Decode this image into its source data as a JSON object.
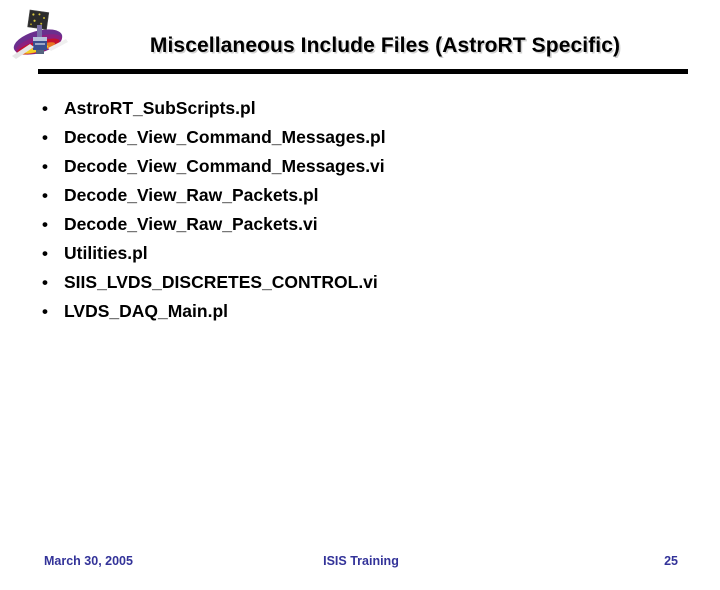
{
  "slide": {
    "title": "Miscellaneous Include Files (AstroRT Specific)",
    "bullet_char": "•",
    "items": [
      {
        "label": "AstroRT_SubScripts.pl"
      },
      {
        "label": "Decode_View_Command_Messages.pl"
      },
      {
        "label": "Decode_View_Command_Messages.vi"
      },
      {
        "label": "Decode_View_Raw_Packets.pl"
      },
      {
        "label": "Decode_View_Raw_Packets.vi"
      },
      {
        "label": "Utilities.pl"
      },
      {
        "label": "SIIS_LVDS_DISCRETES_CONTROL.vi"
      },
      {
        "label": "LVDS_DAQ_Main.pl"
      }
    ]
  },
  "logo": {
    "name": "satellite-observatory-logo",
    "colors": {
      "panel": "#2b2b2b",
      "panel_speck": "#d8c840",
      "disc_purple": "#6b2f8e",
      "disc_magenta": "#a61f6d",
      "disc_red": "#c41230",
      "disc_orange": "#e87722",
      "disc_yellow": "#f2d024",
      "body_blue": "#3a4f8f",
      "body_light": "#b9c3dc",
      "wing": "#e6e6e6"
    }
  },
  "footer": {
    "date": "March 30, 2005",
    "center": "ISIS Training",
    "page": "25",
    "color": "#333399"
  }
}
